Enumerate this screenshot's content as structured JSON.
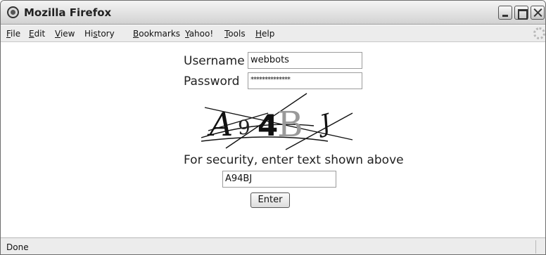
{
  "window": {
    "title": "Mozilla Firefox"
  },
  "menubar": {
    "items": [
      {
        "label": "File",
        "underline": "F",
        "rest": "ile"
      },
      {
        "label": "Edit",
        "underline": "E",
        "rest": "dit"
      },
      {
        "label": "View",
        "underline": "V",
        "rest": "iew"
      },
      {
        "label": "History",
        "pre": "Hi",
        "underline": "s",
        "rest": "tory"
      },
      {
        "label": "Bookmarks",
        "underline": "B",
        "rest": "ookmarks"
      },
      {
        "label": "Yahoo!",
        "underline": "Y",
        "rest": "ahoo!"
      },
      {
        "label": "Tools",
        "underline": "T",
        "rest": "ools"
      },
      {
        "label": "Help",
        "underline": "H",
        "rest": "elp"
      }
    ]
  },
  "form": {
    "username_label": "Username",
    "username_value": "webbots",
    "password_label": "Password",
    "password_value": "**************",
    "captcha_text": "A94BJ",
    "captcha_chars": [
      "A",
      "9",
      "4",
      "B",
      "J"
    ],
    "security_prompt": "For security, enter text shown above",
    "captcha_input_value": "A94BJ",
    "enter_label": "Enter"
  },
  "statusbar": {
    "text": "Done"
  }
}
